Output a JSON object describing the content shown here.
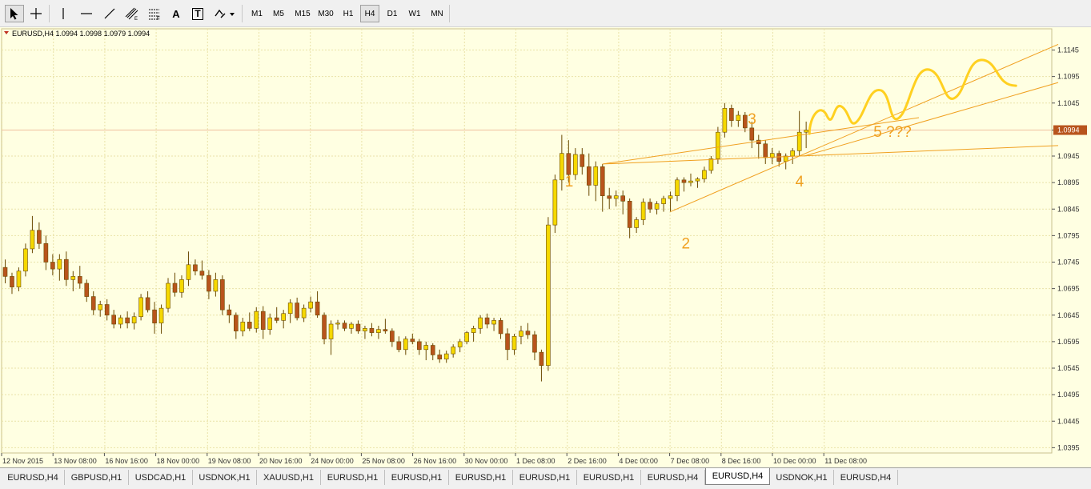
{
  "toolbar": {
    "tools": [
      {
        "name": "cursor-icon"
      },
      {
        "name": "crosshair-icon"
      },
      {
        "name": "vertical-line-icon"
      },
      {
        "name": "horizontal-line-icon"
      },
      {
        "name": "trendline-icon"
      },
      {
        "name": "equidistant-channel-icon"
      },
      {
        "name": "fibonacci-icon"
      },
      {
        "name": "text-icon",
        "glyph": "A"
      },
      {
        "name": "text-label-icon",
        "glyph": "T"
      },
      {
        "name": "shapes-dropdown-icon"
      }
    ],
    "timeframes": [
      "M1",
      "M5",
      "M15",
      "M30",
      "H1",
      "H4",
      "D1",
      "W1",
      "MN"
    ],
    "active_timeframe": "H4"
  },
  "chart": {
    "header": "EURUSD,H4  1.0994 1.0998 1.0979 1.0994",
    "current_price_label": "1.0994",
    "colors": {
      "background": "#ffffe2",
      "grid": "#e9e2a8",
      "bull": "#f5d800",
      "bear": "#b8541c",
      "outline": "#6b4a00",
      "annotation": "#f0a020",
      "wave": "#ffd020",
      "axis_text": "#333333"
    }
  },
  "chart_data": {
    "type": "candlestick",
    "symbol": "EURUSD",
    "timeframe": "H4",
    "ylim": [
      1.0385,
      1.1185
    ],
    "price_ticks": [
      "1.1145",
      "1.1095",
      "1.1045",
      "1.0994",
      "1.0945",
      "1.0895",
      "1.0845",
      "1.0795",
      "1.0745",
      "1.0695",
      "1.0645",
      "1.0595",
      "1.0545",
      "1.0495",
      "1.0445",
      "1.0395"
    ],
    "time_labels": [
      "12 Nov 2015",
      "13 Nov 08:00",
      "16 Nov 16:00",
      "18 Nov 00:00",
      "19 Nov 08:00",
      "20 Nov 16:00",
      "24 Nov 00:00",
      "25 Nov 08:00",
      "26 Nov 16:00",
      "30 Nov 00:00",
      "1 Dec 08:00",
      "2 Dec 16:00",
      "4 Dec 00:00",
      "7 Dec 08:00",
      "8 Dec 16:00",
      "10 Dec 00:00",
      "11 Dec 08:00"
    ],
    "wave_labels": [
      "1",
      "2",
      "3",
      "4",
      "5 ???"
    ],
    "candles": [
      [
        1.0735,
        1.075,
        1.0705,
        1.0718
      ],
      [
        1.0718,
        1.0725,
        1.0685,
        1.0698
      ],
      [
        1.0698,
        1.0735,
        1.069,
        1.0728
      ],
      [
        1.0728,
        1.078,
        1.0718,
        1.077
      ],
      [
        1.077,
        1.0832,
        1.0762,
        1.0805
      ],
      [
        1.0805,
        1.082,
        1.077,
        1.078
      ],
      [
        1.078,
        1.0795,
        1.073,
        1.0745
      ],
      [
        1.0745,
        1.076,
        1.072,
        1.0732
      ],
      [
        1.0732,
        1.076,
        1.071,
        1.075
      ],
      [
        1.075,
        1.0765,
        1.07,
        1.0712
      ],
      [
        1.0712,
        1.0728,
        1.069,
        1.0718
      ],
      [
        1.0718,
        1.0738,
        1.0695,
        1.0705
      ],
      [
        1.0705,
        1.0712,
        1.067,
        1.068
      ],
      [
        1.068,
        1.069,
        1.0645,
        1.0655
      ],
      [
        1.0655,
        1.0672,
        1.0642,
        1.0665
      ],
      [
        1.0665,
        1.0675,
        1.0635,
        1.0645
      ],
      [
        1.0645,
        1.0655,
        1.062,
        1.0628
      ],
      [
        1.0628,
        1.0645,
        1.062,
        1.064
      ],
      [
        1.064,
        1.0652,
        1.062,
        1.063
      ],
      [
        1.063,
        1.065,
        1.0618,
        1.0642
      ],
      [
        1.0642,
        1.0685,
        1.0635,
        1.0678
      ],
      [
        1.0678,
        1.069,
        1.065,
        1.0655
      ],
      [
        1.0655,
        1.067,
        1.061,
        1.063
      ],
      [
        1.063,
        1.0665,
        1.061,
        1.0658
      ],
      [
        1.0658,
        1.0715,
        1.065,
        1.0705
      ],
      [
        1.0705,
        1.0725,
        1.068,
        1.0688
      ],
      [
        1.0688,
        1.072,
        1.0678,
        1.0712
      ],
      [
        1.0712,
        1.0765,
        1.07,
        1.074
      ],
      [
        1.074,
        1.075,
        1.072,
        1.0728
      ],
      [
        1.0728,
        1.0748,
        1.0712,
        1.072
      ],
      [
        1.072,
        1.073,
        1.0675,
        1.069
      ],
      [
        1.069,
        1.0725,
        1.068,
        1.0712
      ],
      [
        1.0712,
        1.072,
        1.0645,
        1.0655
      ],
      [
        1.0655,
        1.0665,
        1.063,
        1.0645
      ],
      [
        1.0645,
        1.065,
        1.06,
        1.0615
      ],
      [
        1.0615,
        1.064,
        1.0605,
        1.0632
      ],
      [
        1.0632,
        1.065,
        1.0615,
        1.062
      ],
      [
        1.062,
        1.066,
        1.0612,
        1.0652
      ],
      [
        1.0652,
        1.0662,
        1.06,
        1.0618
      ],
      [
        1.0618,
        1.0648,
        1.0608,
        1.064
      ],
      [
        1.064,
        1.066,
        1.063,
        1.0635
      ],
      [
        1.0635,
        1.0655,
        1.062,
        1.0648
      ],
      [
        1.0648,
        1.0675,
        1.063,
        1.0668
      ],
      [
        1.0668,
        1.0678,
        1.0635,
        1.064
      ],
      [
        1.064,
        1.0665,
        1.0632,
        1.0658
      ],
      [
        1.0658,
        1.068,
        1.065,
        1.067
      ],
      [
        1.067,
        1.069,
        1.064,
        1.0645
      ],
      [
        1.0645,
        1.065,
        1.059,
        1.06
      ],
      [
        1.06,
        1.0635,
        1.057,
        1.0628
      ],
      [
        1.0628,
        1.0636,
        1.0618,
        1.063
      ],
      [
        1.063,
        1.0635,
        1.0615,
        1.062
      ],
      [
        1.062,
        1.0632,
        1.061,
        1.0628
      ],
      [
        1.0628,
        1.0635,
        1.061,
        1.0615
      ],
      [
        1.0615,
        1.0625,
        1.06,
        1.062
      ],
      [
        1.062,
        1.063,
        1.0605,
        1.0612
      ],
      [
        1.0612,
        1.0625,
        1.06,
        1.0618
      ],
      [
        1.0618,
        1.0638,
        1.061,
        1.0615
      ],
      [
        1.0615,
        1.062,
        1.0585,
        1.0595
      ],
      [
        1.0595,
        1.0605,
        1.0575,
        1.058
      ],
      [
        1.058,
        1.0605,
        1.057,
        1.06
      ],
      [
        1.06,
        1.061,
        1.059,
        1.0595
      ],
      [
        1.0595,
        1.06,
        1.057,
        1.058
      ],
      [
        1.058,
        1.0595,
        1.056,
        1.0588
      ],
      [
        1.0588,
        1.0592,
        1.056,
        1.057
      ],
      [
        1.057,
        1.058,
        1.0555,
        1.0562
      ],
      [
        1.0562,
        1.0578,
        1.0555,
        1.0572
      ],
      [
        1.0572,
        1.059,
        1.0565,
        1.0585
      ],
      [
        1.0585,
        1.06,
        1.0575,
        1.0595
      ],
      [
        1.0595,
        1.0615,
        1.059,
        1.0612
      ],
      [
        1.0612,
        1.0625,
        1.0595,
        1.062
      ],
      [
        1.062,
        1.0645,
        1.061,
        1.064
      ],
      [
        1.064,
        1.0648,
        1.062,
        1.0628
      ],
      [
        1.0628,
        1.064,
        1.0615,
        1.0635
      ],
      [
        1.0635,
        1.064,
        1.06,
        1.061
      ],
      [
        1.061,
        1.062,
        1.056,
        1.058
      ],
      [
        1.058,
        1.061,
        1.057,
        1.0605
      ],
      [
        1.0605,
        1.0625,
        1.059,
        1.0615
      ],
      [
        1.0615,
        1.063,
        1.06,
        1.0608
      ],
      [
        1.0608,
        1.0615,
        1.056,
        1.0575
      ],
      [
        1.0575,
        1.058,
        1.052,
        1.055
      ],
      [
        1.055,
        1.083,
        1.054,
        1.0815
      ],
      [
        1.0815,
        1.091,
        1.08,
        1.09
      ],
      [
        1.09,
        1.0985,
        1.088,
        1.095
      ],
      [
        1.095,
        1.0975,
        1.0895,
        1.091
      ],
      [
        1.091,
        1.096,
        1.09,
        1.0948
      ],
      [
        1.0948,
        1.096,
        1.091,
        1.0925
      ],
      [
        1.0925,
        1.095,
        1.087,
        1.089
      ],
      [
        1.089,
        1.0935,
        1.086,
        1.0925
      ],
      [
        1.0925,
        1.093,
        1.084,
        1.087
      ],
      [
        1.087,
        1.0885,
        1.0845,
        1.0865
      ],
      [
        1.0865,
        1.088,
        1.085,
        1.087
      ],
      [
        1.087,
        1.088,
        1.0835,
        1.086
      ],
      [
        1.086,
        1.0865,
        1.079,
        1.081
      ],
      [
        1.081,
        1.083,
        1.08,
        1.0825
      ],
      [
        1.0825,
        1.0865,
        1.0815,
        1.0858
      ],
      [
        1.0858,
        1.0865,
        1.0838,
        1.0845
      ],
      [
        1.0845,
        1.086,
        1.0835,
        1.0855
      ],
      [
        1.0855,
        1.087,
        1.084,
        1.0865
      ],
      [
        1.0865,
        1.0878,
        1.084,
        1.087
      ],
      [
        1.087,
        1.0905,
        1.086,
        1.09
      ],
      [
        1.09,
        1.0905,
        1.0878,
        1.0895
      ],
      [
        1.0895,
        1.0912,
        1.0888,
        1.0898
      ],
      [
        1.0898,
        1.0905,
        1.0885,
        1.0902
      ],
      [
        1.0902,
        1.0925,
        1.0895,
        1.0918
      ],
      [
        1.0918,
        1.0945,
        1.0912,
        1.094
      ],
      [
        1.094,
        1.1,
        1.093,
        1.099
      ],
      [
        1.099,
        1.1045,
        1.098,
        1.1035
      ],
      [
        1.1035,
        1.1042,
        1.1,
        1.1012
      ],
      [
        1.1012,
        1.103,
        1.1,
        1.1022
      ],
      [
        1.1022,
        1.1028,
        1.099,
        1.0998
      ],
      [
        1.0998,
        1.101,
        1.096,
        1.0975
      ],
      [
        1.0975,
        1.0985,
        1.094,
        1.0968
      ],
      [
        1.0968,
        1.0975,
        1.093,
        1.0942
      ],
      [
        1.0942,
        1.096,
        1.093,
        1.095
      ],
      [
        1.095,
        1.0955,
        1.0925,
        1.0935
      ],
      [
        1.0935,
        1.095,
        1.092,
        1.0945
      ],
      [
        1.0945,
        1.096,
        1.093,
        1.0955
      ],
      [
        1.0955,
        1.103,
        1.0945,
        1.099
      ],
      [
        1.099,
        1.101,
        1.096,
        1.0994
      ]
    ]
  },
  "tabs": [
    {
      "label": "EURUSD,H4"
    },
    {
      "label": "GBPUSD,H1"
    },
    {
      "label": "USDCAD,H1"
    },
    {
      "label": "USDNOK,H1"
    },
    {
      "label": "XAUUSD,H1"
    },
    {
      "label": "EURUSD,H1"
    },
    {
      "label": "EURUSD,H1"
    },
    {
      "label": "EURUSD,H1"
    },
    {
      "label": "EURUSD,H1"
    },
    {
      "label": "EURUSD,H1"
    },
    {
      "label": "EURUSD,H4"
    },
    {
      "label": "EURUSD,H4",
      "active": true
    },
    {
      "label": "USDNOK,H1"
    },
    {
      "label": "EURUSD,H4"
    }
  ]
}
